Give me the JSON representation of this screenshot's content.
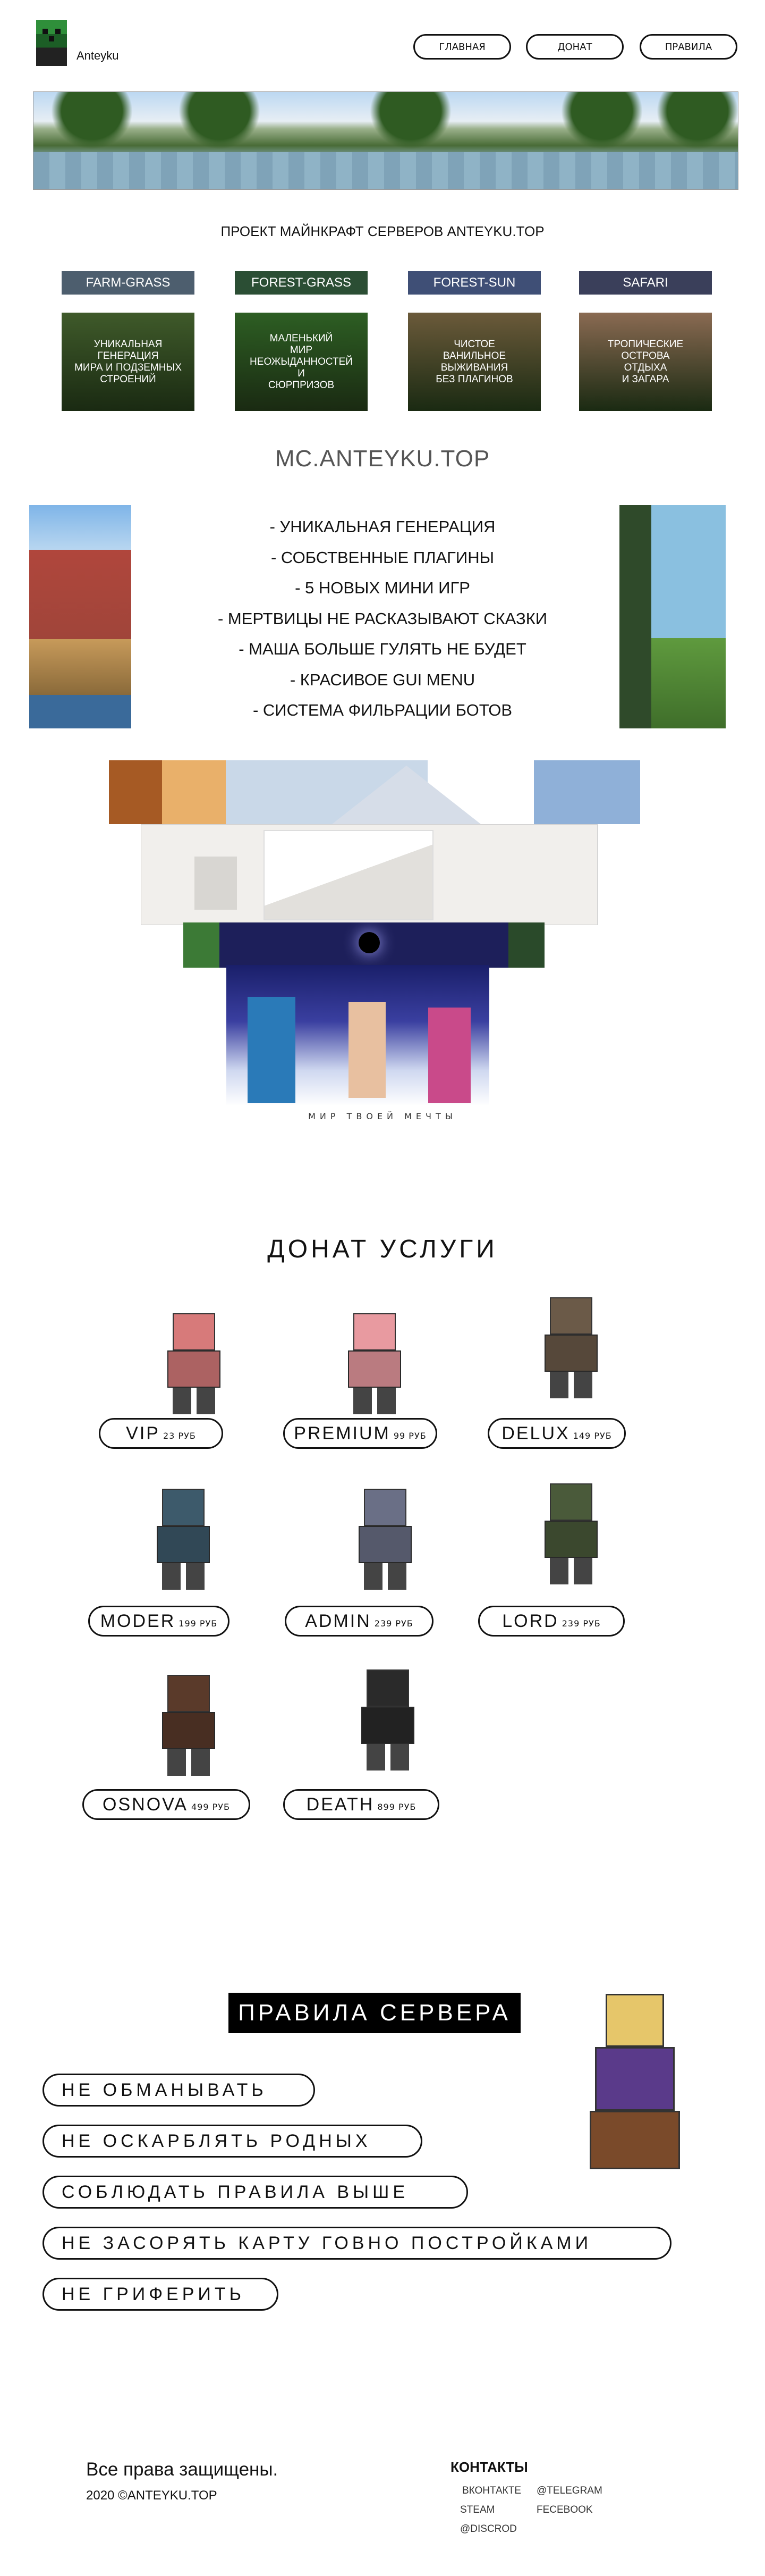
{
  "header": {
    "logo_text": "Anteyku",
    "nav": [
      "ГЛАВНАЯ",
      "ДОНАТ",
      "ПРАВИЛА"
    ]
  },
  "intro": {
    "title": "ПРОЕКТ МАЙНКРАФТ СЕРВЕРОВ ANTEYKU.TOP"
  },
  "servers": [
    {
      "name": "FARM-GRASS",
      "description": "УНИКАЛЬНАЯ\nГЕНЕРАЦИЯ\nМИРА И ПОДЗЕМНЫХ\nСТРОЕНИЙ",
      "label_color": "#4d5e6e",
      "card_color": "#3f5a2a"
    },
    {
      "name": "FOREST-GRASS",
      "description": "МАЛЕНЬКИЙ\nМИР\nНЕОЖЫДАННОСТЕЙ\nИ\nСЮРПРИЗОВ",
      "label_color": "#2b4e34",
      "card_color": "#2d5e23"
    },
    {
      "name": "FOREST-SUN",
      "description": "ЧИСТОЕ\nВАНИЛЬНОЕ\nВЫЖИВАНИЯ\nБЕЗ ПЛАГИНОВ",
      "label_color": "#3f4f76",
      "card_color": "#6b5a3a"
    },
    {
      "name": "SAFARI",
      "description": "ТРОПИЧЕСКИЕ\nОСТРОВА\nОТДЫХА\nИ ЗАГАРА",
      "label_color": "#3a3f5a",
      "card_color": "#8a6a52"
    }
  ],
  "mc": {
    "title": "MC.ANTEYKU.TOP",
    "features": [
      "- УНИКАЛЬНАЯ ГЕНЕРАЦИЯ",
      "- СОБСТВЕННЫЕ ПЛАГИНЫ",
      "- 5 НОВЫХ МИНИ ИГР",
      "- МЕРТВИЦЫ НЕ РАСКАЗЫВАЮТ СКАЗКИ",
      "- МАША БОЛЬШЕ ГУЛЯТЬ НЕ БУДЕТ",
      "- КРАСИВОЕ GUI MENU",
      "- СИСТЕМА ФИЛЬРАЦИИ БОТОВ"
    ]
  },
  "world_caption": "МИР ТВОЕЙ МЕЧТЫ",
  "donat": {
    "title": "ДОНАТ УСЛУГИ",
    "items": [
      {
        "name": "VIP",
        "price": "23 РУБ",
        "char_color": "#d77a7a"
      },
      {
        "name": "PREMIUM",
        "price": "99 РУБ",
        "char_color": "#e89aa0"
      },
      {
        "name": "DELUX",
        "price": "149 РУБ",
        "char_color": "#6b5a48"
      },
      {
        "name": "MODER",
        "price": "199 РУБ",
        "char_color": "#3d5a6b"
      },
      {
        "name": "ADMIN",
        "price": "239 РУБ",
        "char_color": "#6a6f86"
      },
      {
        "name": "LORD",
        "price": "239 РУБ",
        "char_color": "#4a5a3a"
      },
      {
        "name": "OSNOVA",
        "price": "499 РУБ",
        "char_color": "#5a3a2a"
      },
      {
        "name": "DEATH",
        "price": "899 РУБ",
        "char_color": "#2a2a2a"
      }
    ]
  },
  "rules": {
    "title": "ПРАВИЛА СЕРВЕРА",
    "items": [
      "НЕ ОБМАНЫВАТЬ",
      "НЕ ОСКАРБЛЯТЬ РОДНЫХ",
      "СОБЛЮДАТЬ ПРАВИЛА ВЫШЕ",
      "НЕ ЗАСОРЯТЬ КАРТУ ГОВНО ПОСТРОЙКАМИ",
      "НЕ ГРИФЕРИТЬ"
    ]
  },
  "footer": {
    "rights": "Все права защищены.",
    "copyright": "2020 ©ANTEYKU.TOP",
    "contacts_title": "КОНТАКТЫ",
    "contacts": [
      "ВКОНТАКТЕ",
      "@TELEGRAM",
      "STEAM",
      "FECEBOOK",
      "@DISCROD"
    ]
  }
}
